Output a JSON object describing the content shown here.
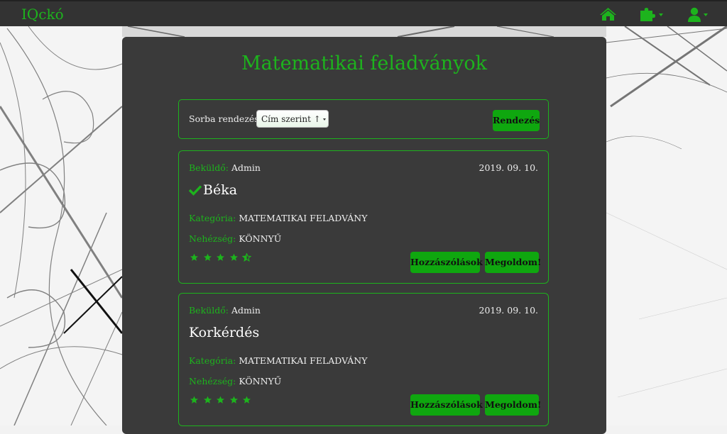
{
  "navbar": {
    "brand": "IQckó",
    "icons": [
      "home-icon",
      "puzzle-icon",
      "user-icon"
    ]
  },
  "page": {
    "title": "Matematikai feladványok"
  },
  "sort": {
    "label": "Sorba rendezés:",
    "selected": "Cím szerint ↑",
    "button_label": "Rendezés"
  },
  "tasks": [
    {
      "submitter_label": "Beküldő:",
      "submitter": "Admin",
      "date": "2019. 09. 10.",
      "title": "Béka",
      "solved": true,
      "category_label": "Kategória:",
      "category": "MATEMATIKAI FELADVÁNY",
      "difficulty_label": "Nehézség:",
      "difficulty": "KÖNNYŰ",
      "rating": 4.5,
      "comments_label": "Hozzászólások",
      "solve_label": "Megoldom!"
    },
    {
      "submitter_label": "Beküldő:",
      "submitter": "Admin",
      "date": "2019. 09. 10.",
      "title": "Korkérdés",
      "solved": false,
      "category_label": "Kategória:",
      "category": "MATEMATIKAI FELADVÁNY",
      "difficulty_label": "Nehézség:",
      "difficulty": "KÖNNYŰ",
      "rating": 5,
      "comments_label": "Hozzászólások",
      "solve_label": "Megoldom!"
    }
  ],
  "colors": {
    "accent": "#1db31d",
    "button": "#0fa70f",
    "panel": "#3a3a3a",
    "navbar": "#333333"
  }
}
